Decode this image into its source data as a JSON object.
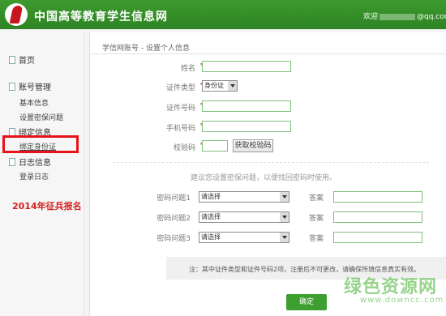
{
  "header": {
    "site_title": "中国高等教育学生信息网",
    "welcome_label": "欢迎",
    "email_suffix": "@qq.com"
  },
  "sidebar": {
    "home": "首页",
    "account_section": "账号管理",
    "basic_info": "基本信息",
    "security_question": "设置密保问题",
    "binding_section": "绑定信息",
    "bind_id": "绑定身份证",
    "log_section": "日志信息",
    "login_log": "登录日志",
    "enrollment": "2014年征兵报名"
  },
  "form": {
    "breadcrumb": "学信网账号 - 设置个人信息",
    "name_label": "姓名",
    "id_type_label": "证件类型",
    "id_type_value": "身份证",
    "id_number_label": "证件号码",
    "phone_label": "手机号码",
    "captcha_label": "校验码",
    "get_code_button": "获取校验码",
    "hint": "建议您设置密保问题，以便找回密码时使用。",
    "q1_label": "密码问题1",
    "q2_label": "密码问题2",
    "q3_label": "密码问题3",
    "select_placeholder": "请选择",
    "answer_label": "答案",
    "note": "注：其中证件类型和证件号码2项，注册后不可更改，请确保所填信息真实有效。",
    "confirm_button": "确定"
  },
  "watermark": {
    "text": "绿色资源网",
    "url": "www.downcc.com"
  }
}
